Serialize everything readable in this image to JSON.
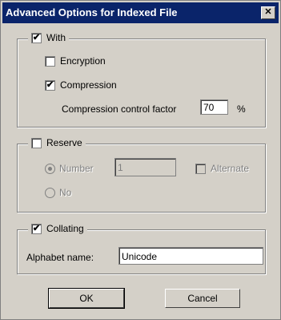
{
  "window": {
    "title": "Advanced Options for Indexed File",
    "close_symbol": "✕"
  },
  "with_group": {
    "label": "With",
    "checked": true,
    "encryption": {
      "label": "Encryption",
      "checked": false
    },
    "compression": {
      "label": "Compression",
      "checked": true
    },
    "factor": {
      "label": "Compression control factor",
      "value": "70",
      "unit": "%"
    }
  },
  "reserve_group": {
    "label": "Reserve",
    "checked": false,
    "number": {
      "label": "Number",
      "value": "1",
      "selected": true
    },
    "alternate": {
      "label": "Alternate",
      "checked": false
    },
    "no": {
      "label": "No",
      "selected": false
    }
  },
  "collating_group": {
    "label": "Collating",
    "checked": true,
    "alphabet": {
      "label": "Alphabet name:",
      "value": "Unicode"
    }
  },
  "buttons": {
    "ok": "OK",
    "cancel": "Cancel"
  },
  "check_mark": "✔"
}
